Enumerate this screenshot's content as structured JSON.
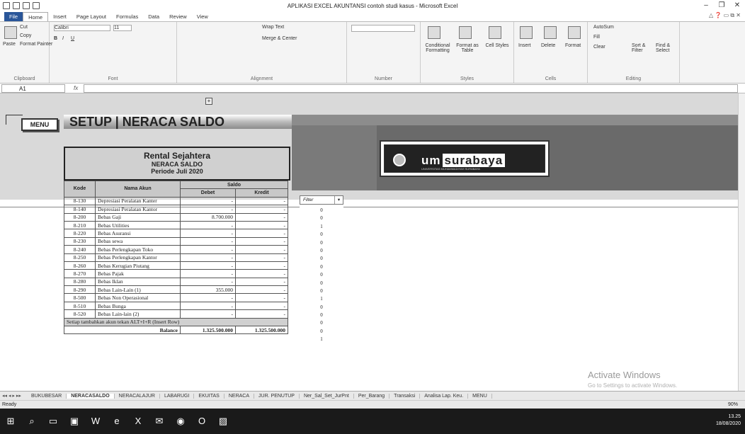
{
  "window": {
    "title": "APLIKASI EXCEL AKUNTANSI contoh studi kasus  -  Microsoft Excel"
  },
  "ribbon_tabs": [
    "File",
    "Home",
    "Insert",
    "Page Layout",
    "Formulas",
    "Data",
    "Review",
    "View"
  ],
  "ribbon": {
    "clipboard": {
      "paste": "Paste",
      "cut": "Cut",
      "copy": "Copy",
      "format_painter": "Format Painter",
      "label": "Clipboard"
    },
    "font": {
      "name": "Calibri",
      "size": "11",
      "label": "Font"
    },
    "alignment": {
      "wrap": "Wrap Text",
      "merge": "Merge & Center",
      "label": "Alignment"
    },
    "number": {
      "label": "Number"
    },
    "styles": {
      "conditional": "Conditional Formatting",
      "format_table": "Format as Table",
      "cell_styles": "Cell Styles",
      "label": "Styles"
    },
    "cells": {
      "insert": "Insert",
      "delete": "Delete",
      "format": "Format",
      "label": "Cells"
    },
    "editing": {
      "autosum": "AutoSum",
      "fill": "Fill",
      "clear": "Clear",
      "sort": "Sort & Filter",
      "find": "Find & Select",
      "label": "Editing"
    }
  },
  "formula_bar": {
    "name_box": "A1",
    "fx": "fx",
    "value": ""
  },
  "sheet": {
    "menu_button": "MENU",
    "title": "SETUP | NERACA SALDO",
    "add_button": "+",
    "company": "Rental Sejahtera",
    "report": "NERACA SALDO",
    "period": "Periode Juli 2020",
    "logo": {
      "um": "um",
      "surabaya": "surabaya",
      "sub": "UNIVERSITAS MUHAMMADIYAH SURABAYA"
    },
    "headers": {
      "kode": "Kode",
      "nama": "Nama Akun",
      "saldo": "Saldo",
      "debet": "Debet",
      "kredit": "Kredit"
    },
    "filter_label": "Filter",
    "rows": [
      {
        "kode": "8-130",
        "nama": "Depresiasi Peralatan Kanter",
        "debet": "-",
        "kredit": "-",
        "f": "0"
      },
      {
        "kode": "8-140",
        "nama": "Depresiasi Peralatan Kantor",
        "debet": "-",
        "kredit": "-",
        "f": "0"
      },
      {
        "kode": "8-200",
        "nama": "Bebas Gaji",
        "debet": "8.700.000",
        "kredit": "-",
        "f": "1"
      },
      {
        "kode": "8-210",
        "nama": "Bebas Utilities",
        "debet": "-",
        "kredit": "-",
        "f": "0"
      },
      {
        "kode": "8-220",
        "nama": "Bebas Asuransi",
        "debet": "-",
        "kredit": "-",
        "f": "0"
      },
      {
        "kode": "8-230",
        "nama": "Bebas sewa",
        "debet": "-",
        "kredit": "-",
        "f": "0"
      },
      {
        "kode": "8-240",
        "nama": "Bebas Perlengkapan Toko",
        "debet": "-",
        "kredit": "-",
        "f": "0"
      },
      {
        "kode": "8-250",
        "nama": "Bebas Perlengkapan Kantor",
        "debet": "-",
        "kredit": "-",
        "f": "0"
      },
      {
        "kode": "8-260",
        "nama": "Bebas Kerugian Piutang",
        "debet": "-",
        "kredit": "-",
        "f": "0"
      },
      {
        "kode": "8-270",
        "nama": "Bebas Pajak",
        "debet": "-",
        "kredit": "-",
        "f": "0"
      },
      {
        "kode": "8-280",
        "nama": "Bebas Iklan",
        "debet": "-",
        "kredit": "-",
        "f": "0"
      },
      {
        "kode": "8-290",
        "nama": "Bebas Lain-Lain (1)",
        "debet": "355.000",
        "kredit": "-",
        "f": "1"
      },
      {
        "kode": "8-500",
        "nama": "Bebas Non Operasional",
        "debet": "-",
        "kredit": "-",
        "f": "0"
      },
      {
        "kode": "8-510",
        "nama": "Bebas Bunga",
        "debet": "-",
        "kredit": "-",
        "f": "0"
      },
      {
        "kode": "8-520",
        "nama": "Bebas Lain-lain (2)",
        "debet": "-",
        "kredit": "-",
        "f": "0"
      }
    ],
    "note": "Setiap tambahkan akun tekan ALT+I+R (Insert Row)",
    "note_f": "0",
    "balance": {
      "label": "Balance",
      "debet": "1.325.500.000",
      "kredit": "1.325.500.000",
      "f": "1"
    },
    "activate": "Activate Windows",
    "activate_sub": "Go to Settings to activate Windows."
  },
  "sheet_tabs": [
    "BUKUBESAR",
    "NERACASALDO",
    "NERACALAJUR",
    "LABARUGI",
    "EKUITAS",
    "NERACA",
    "JUR. PENUTUP",
    "Ner_Sal_Set_JurPnt",
    "Per_Barang",
    "Transaksi",
    "Analisa Lap. Keu.",
    "MENU"
  ],
  "active_tab": "NERACASALDO",
  "status": {
    "ready": "Ready",
    "zoom": "90%"
  },
  "taskbar": {
    "time": "13.25",
    "date": "18/08/2020"
  }
}
